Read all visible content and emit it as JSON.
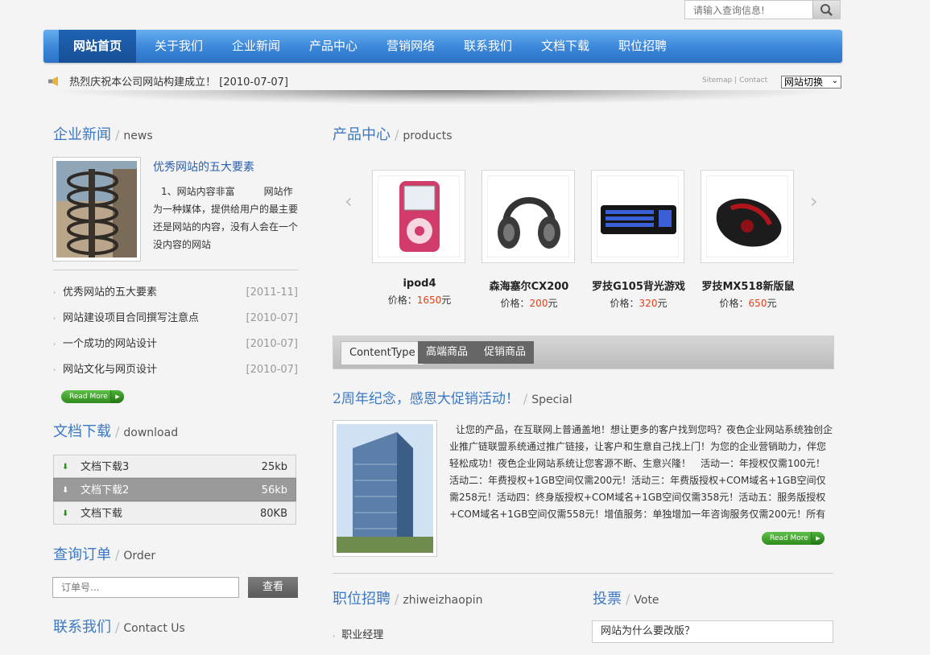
{
  "search": {
    "placeholder": "请输入查询信息!"
  },
  "nav": [
    {
      "label": "网站首页",
      "active": true
    },
    {
      "label": "关于我们"
    },
    {
      "label": "企业新闻"
    },
    {
      "label": "产品中心"
    },
    {
      "label": "营销网络"
    },
    {
      "label": "联系我们"
    },
    {
      "label": "文档下载"
    },
    {
      "label": "职位招聘"
    }
  ],
  "notice": {
    "text": "热烈庆祝本公司网站构建成立！ [2010-07-07]"
  },
  "toplinks": {
    "sitemap": "Sitemap",
    "sep": "|",
    "contact": "Contact",
    "switch": "网站切换"
  },
  "news": {
    "title": "企业新闻",
    "en": "news",
    "featured": {
      "title": "优秀网站的五大要素",
      "body": "1、网站内容非富　　　网站作为一种媒体，提供给用户的最主要还是网站的内容，没有人会在一个没内容的网站"
    },
    "items": [
      {
        "title": "优秀网站的五大要素",
        "date": "[2011-11]"
      },
      {
        "title": "网站建设项目合同撰写注意点",
        "date": "[2010-07]"
      },
      {
        "title": "一个成功的网站设计",
        "date": "[2010-07]"
      },
      {
        "title": "网站文化与网页设计",
        "date": "[2010-07]"
      }
    ],
    "readmore": "Read More"
  },
  "download": {
    "title": "文档下载",
    "en": "download",
    "items": [
      {
        "name": "文档下载3",
        "size": "25kb"
      },
      {
        "name": "文档下载2",
        "size": "56kb"
      },
      {
        "name": "文档下载",
        "size": "80KB"
      }
    ]
  },
  "order": {
    "title": "查询订单",
    "en": "Order",
    "placeholder": "订单号...",
    "button": "查看"
  },
  "contact": {
    "title": "联系我们",
    "en": "Contact Us"
  },
  "products": {
    "title": "产品中心",
    "en": "products",
    "price_label": "价格：",
    "unit": "元",
    "items": [
      {
        "name": "ipod4",
        "price": "1650",
        "icon": "ipod-image"
      },
      {
        "name": "森海塞尔CX200",
        "price": "200",
        "icon": "headphones-image"
      },
      {
        "name": "罗技G105背光游戏",
        "price": "320",
        "icon": "keyboard-image"
      },
      {
        "name": "罗技MX518新版鼠",
        "price": "650",
        "icon": "mouse-image"
      }
    ]
  },
  "tabs": [
    "ContentType",
    "高端商品",
    "促销商品"
  ],
  "special": {
    "title": "2周年纪念，感恩大促销活动！",
    "en": "Special",
    "body": "让您的产品，在互联网上普通盖地！想让更多的客户找到您吗？夜色企业网站系统独创企业推广链联盟系统通过推广链接，让客户和生意自己找上门！为您的企业营销助力，伴您轻松成功！夜色企业网站系统让您客源不断、生意兴隆！　活动一：年授权仅需100元！活动二：年费授权+1GB空间仅需200元！活动三：年费版授权+COM域名+1GB空间仅需258元！活动四：终身版授权+COM域名+1GB空间仅需358元！活动五：服务版授权+COM域名+1GB空间仅需558元！增值服务：单独增加一年咨询服务仅需200元！所有",
    "readmore": "Read More"
  },
  "jobs": {
    "title": "职位招聘",
    "en": "zhiweizhaopin",
    "items": [
      "职业经理"
    ]
  },
  "vote": {
    "title": "投票",
    "en": "Vote",
    "question": "网站为什么要改版？"
  }
}
